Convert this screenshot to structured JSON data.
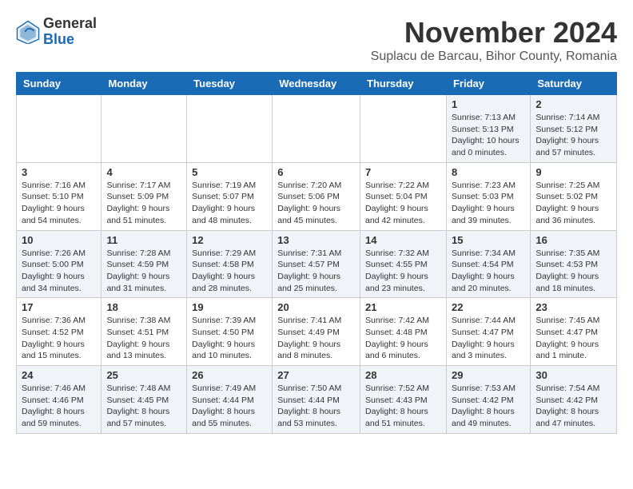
{
  "logo": {
    "general": "General",
    "blue": "Blue"
  },
  "title": {
    "month_year": "November 2024",
    "location": "Suplacu de Barcau, Bihor County, Romania"
  },
  "weekdays": [
    "Sunday",
    "Monday",
    "Tuesday",
    "Wednesday",
    "Thursday",
    "Friday",
    "Saturday"
  ],
  "weeks": [
    [
      {
        "day": "",
        "info": ""
      },
      {
        "day": "",
        "info": ""
      },
      {
        "day": "",
        "info": ""
      },
      {
        "day": "",
        "info": ""
      },
      {
        "day": "",
        "info": ""
      },
      {
        "day": "1",
        "info": "Sunrise: 7:13 AM\nSunset: 5:13 PM\nDaylight: 10 hours\nand 0 minutes."
      },
      {
        "day": "2",
        "info": "Sunrise: 7:14 AM\nSunset: 5:12 PM\nDaylight: 9 hours\nand 57 minutes."
      }
    ],
    [
      {
        "day": "3",
        "info": "Sunrise: 7:16 AM\nSunset: 5:10 PM\nDaylight: 9 hours\nand 54 minutes."
      },
      {
        "day": "4",
        "info": "Sunrise: 7:17 AM\nSunset: 5:09 PM\nDaylight: 9 hours\nand 51 minutes."
      },
      {
        "day": "5",
        "info": "Sunrise: 7:19 AM\nSunset: 5:07 PM\nDaylight: 9 hours\nand 48 minutes."
      },
      {
        "day": "6",
        "info": "Sunrise: 7:20 AM\nSunset: 5:06 PM\nDaylight: 9 hours\nand 45 minutes."
      },
      {
        "day": "7",
        "info": "Sunrise: 7:22 AM\nSunset: 5:04 PM\nDaylight: 9 hours\nand 42 minutes."
      },
      {
        "day": "8",
        "info": "Sunrise: 7:23 AM\nSunset: 5:03 PM\nDaylight: 9 hours\nand 39 minutes."
      },
      {
        "day": "9",
        "info": "Sunrise: 7:25 AM\nSunset: 5:02 PM\nDaylight: 9 hours\nand 36 minutes."
      }
    ],
    [
      {
        "day": "10",
        "info": "Sunrise: 7:26 AM\nSunset: 5:00 PM\nDaylight: 9 hours\nand 34 minutes."
      },
      {
        "day": "11",
        "info": "Sunrise: 7:28 AM\nSunset: 4:59 PM\nDaylight: 9 hours\nand 31 minutes."
      },
      {
        "day": "12",
        "info": "Sunrise: 7:29 AM\nSunset: 4:58 PM\nDaylight: 9 hours\nand 28 minutes."
      },
      {
        "day": "13",
        "info": "Sunrise: 7:31 AM\nSunset: 4:57 PM\nDaylight: 9 hours\nand 25 minutes."
      },
      {
        "day": "14",
        "info": "Sunrise: 7:32 AM\nSunset: 4:55 PM\nDaylight: 9 hours\nand 23 minutes."
      },
      {
        "day": "15",
        "info": "Sunrise: 7:34 AM\nSunset: 4:54 PM\nDaylight: 9 hours\nand 20 minutes."
      },
      {
        "day": "16",
        "info": "Sunrise: 7:35 AM\nSunset: 4:53 PM\nDaylight: 9 hours\nand 18 minutes."
      }
    ],
    [
      {
        "day": "17",
        "info": "Sunrise: 7:36 AM\nSunset: 4:52 PM\nDaylight: 9 hours\nand 15 minutes."
      },
      {
        "day": "18",
        "info": "Sunrise: 7:38 AM\nSunset: 4:51 PM\nDaylight: 9 hours\nand 13 minutes."
      },
      {
        "day": "19",
        "info": "Sunrise: 7:39 AM\nSunset: 4:50 PM\nDaylight: 9 hours\nand 10 minutes."
      },
      {
        "day": "20",
        "info": "Sunrise: 7:41 AM\nSunset: 4:49 PM\nDaylight: 9 hours\nand 8 minutes."
      },
      {
        "day": "21",
        "info": "Sunrise: 7:42 AM\nSunset: 4:48 PM\nDaylight: 9 hours\nand 6 minutes."
      },
      {
        "day": "22",
        "info": "Sunrise: 7:44 AM\nSunset: 4:47 PM\nDaylight: 9 hours\nand 3 minutes."
      },
      {
        "day": "23",
        "info": "Sunrise: 7:45 AM\nSunset: 4:47 PM\nDaylight: 9 hours\nand 1 minute."
      }
    ],
    [
      {
        "day": "24",
        "info": "Sunrise: 7:46 AM\nSunset: 4:46 PM\nDaylight: 8 hours\nand 59 minutes."
      },
      {
        "day": "25",
        "info": "Sunrise: 7:48 AM\nSunset: 4:45 PM\nDaylight: 8 hours\nand 57 minutes."
      },
      {
        "day": "26",
        "info": "Sunrise: 7:49 AM\nSunset: 4:44 PM\nDaylight: 8 hours\nand 55 minutes."
      },
      {
        "day": "27",
        "info": "Sunrise: 7:50 AM\nSunset: 4:44 PM\nDaylight: 8 hours\nand 53 minutes."
      },
      {
        "day": "28",
        "info": "Sunrise: 7:52 AM\nSunset: 4:43 PM\nDaylight: 8 hours\nand 51 minutes."
      },
      {
        "day": "29",
        "info": "Sunrise: 7:53 AM\nSunset: 4:42 PM\nDaylight: 8 hours\nand 49 minutes."
      },
      {
        "day": "30",
        "info": "Sunrise: 7:54 AM\nSunset: 4:42 PM\nDaylight: 8 hours\nand 47 minutes."
      }
    ]
  ]
}
